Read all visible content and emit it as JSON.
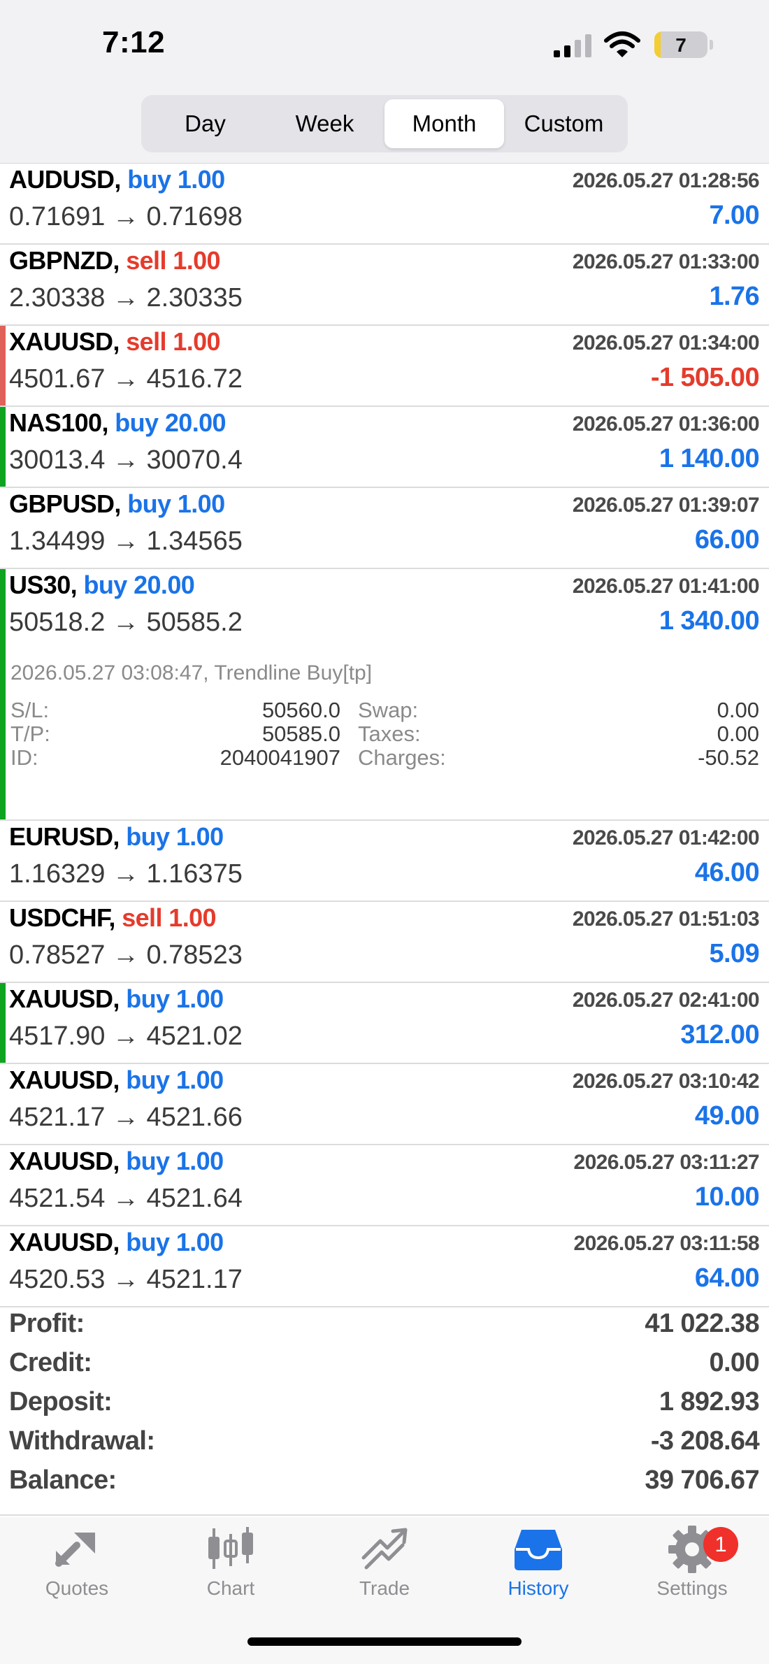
{
  "status_bar": {
    "time": "7:12",
    "battery": "7"
  },
  "period_tabs": [
    {
      "label": "Day",
      "active": false
    },
    {
      "label": "Week",
      "active": false
    },
    {
      "label": "Month",
      "active": true
    },
    {
      "label": "Custom",
      "active": false
    }
  ],
  "colors": {
    "accent": "#1a73e8",
    "sell": "#e53b2c",
    "profit_bar": "#0ea420",
    "loss_bar": "#e0605a"
  },
  "deals": [
    {
      "symbol": "AUDUSD,",
      "side": "buy 1.00",
      "side_color": "blue",
      "datetime": "2026.05.27 01:28:56",
      "prices": "0.71691 → 0.71698",
      "profit": "7.00",
      "profit_color": "blue",
      "bar": ""
    },
    {
      "symbol": "GBPNZD,",
      "side": "sell 1.00",
      "side_color": "red",
      "datetime": "2026.05.27 01:33:00",
      "prices": "2.30338 → 2.30335",
      "profit": "1.76",
      "profit_color": "blue",
      "bar": ""
    },
    {
      "symbol": "XAUUSD,",
      "side": "sell 1.00",
      "side_color": "red",
      "datetime": "2026.05.27 01:34:00",
      "prices": "4501.67 → 4516.72",
      "profit": "-1 505.00",
      "profit_color": "red",
      "bar": "loss"
    },
    {
      "symbol": "NAS100,",
      "side": "buy 20.00",
      "side_color": "blue",
      "datetime": "2026.05.27 01:36:00",
      "prices": "30013.4 → 30070.4",
      "profit": "1 140.00",
      "profit_color": "blue",
      "bar": "profit"
    },
    {
      "symbol": "GBPUSD,",
      "side": "buy 1.00",
      "side_color": "blue",
      "datetime": "2026.05.27 01:39:07",
      "prices": "1.34499 → 1.34565",
      "profit": "66.00",
      "profit_color": "blue",
      "bar": ""
    },
    {
      "symbol": "US30,",
      "side": "buy 20.00",
      "side_color": "blue",
      "datetime": "2026.05.27 01:41:00",
      "prices": "50518.2 → 50585.2",
      "profit": "1 340.00",
      "profit_color": "blue",
      "bar": "profit",
      "expanded": true,
      "details": {
        "comment": "2026.05.27 03:08:47, Trendline Buy[tp]",
        "sl_label": "S/L:",
        "sl_value": "50560.0",
        "tp_label": "T/P:",
        "tp_value": "50585.0",
        "id_label": "ID:",
        "id_value": "2040041907",
        "swap_label": "Swap:",
        "swap_value": "0.00",
        "taxes_label": "Taxes:",
        "taxes_value": "0.00",
        "charges_label": "Charges:",
        "charges_value": "-50.52"
      }
    },
    {
      "symbol": "EURUSD,",
      "side": "buy 1.00",
      "side_color": "blue",
      "datetime": "2026.05.27 01:42:00",
      "prices": "1.16329 → 1.16375",
      "profit": "46.00",
      "profit_color": "blue",
      "bar": ""
    },
    {
      "symbol": "USDCHF,",
      "side": "sell 1.00",
      "side_color": "red",
      "datetime": "2026.05.27 01:51:03",
      "prices": "0.78527 → 0.78523",
      "profit": "5.09",
      "profit_color": "blue",
      "bar": ""
    },
    {
      "symbol": "XAUUSD,",
      "side": "buy 1.00",
      "side_color": "blue",
      "datetime": "2026.05.27 02:41:00",
      "prices": "4517.90 → 4521.02",
      "profit": "312.00",
      "profit_color": "blue",
      "bar": "profit"
    },
    {
      "symbol": "XAUUSD,",
      "side": "buy 1.00",
      "side_color": "blue",
      "datetime": "2026.05.27 03:10:42",
      "prices": "4521.17 → 4521.66",
      "profit": "49.00",
      "profit_color": "blue",
      "bar": ""
    },
    {
      "symbol": "XAUUSD,",
      "side": "buy 1.00",
      "side_color": "blue",
      "datetime": "2026.05.27 03:11:27",
      "prices": "4521.54 → 4521.64",
      "profit": "10.00",
      "profit_color": "blue",
      "bar": ""
    },
    {
      "symbol": "XAUUSD,",
      "side": "buy 1.00",
      "side_color": "blue",
      "datetime": "2026.05.27 03:11:58",
      "prices": "4520.53 → 4521.17",
      "profit": "64.00",
      "profit_color": "blue",
      "bar": ""
    }
  ],
  "summary": [
    {
      "label": "Profit:",
      "value": "41 022.38"
    },
    {
      "label": "Credit:",
      "value": "0.00"
    },
    {
      "label": "Deposit:",
      "value": "1 892.93"
    },
    {
      "label": "Withdrawal:",
      "value": "-3 208.64"
    },
    {
      "label": "Balance:",
      "value": "39 706.67"
    }
  ],
  "tab_bar": [
    {
      "label": "Quotes",
      "icon": "quotes-icon",
      "active": false
    },
    {
      "label": "Chart",
      "icon": "chart-icon",
      "active": false
    },
    {
      "label": "Trade",
      "icon": "trade-icon",
      "active": false
    },
    {
      "label": "History",
      "icon": "history-icon",
      "active": true
    },
    {
      "label": "Settings",
      "icon": "gear-icon",
      "active": false,
      "badge": "1"
    }
  ]
}
